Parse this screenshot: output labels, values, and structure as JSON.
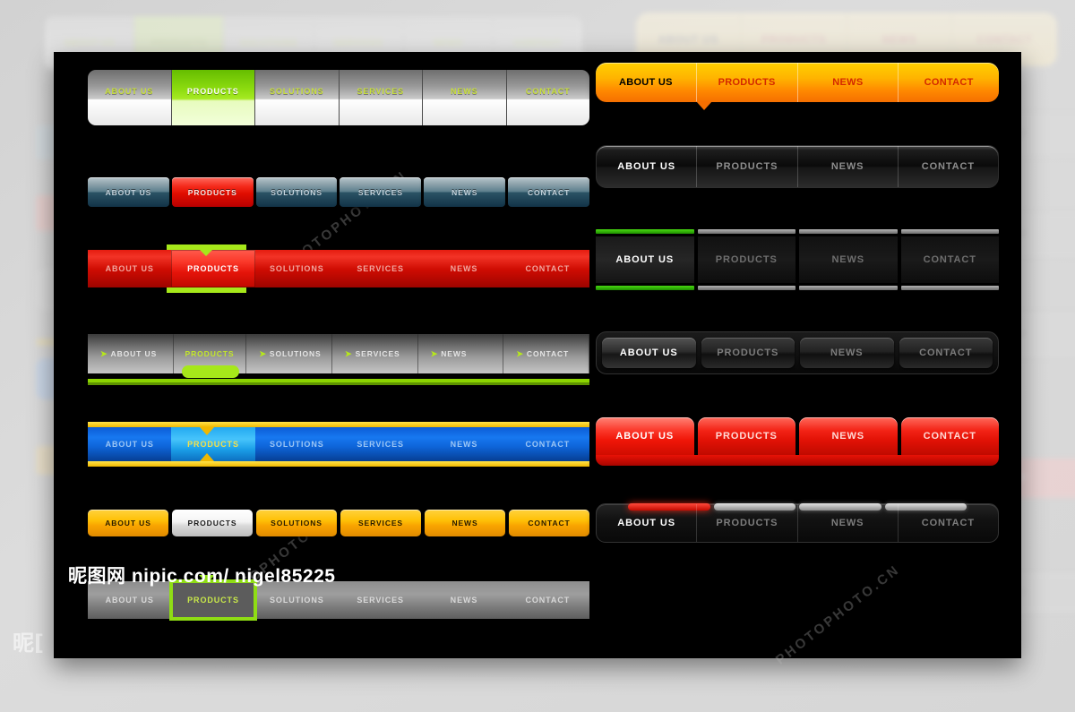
{
  "page": {
    "background_color": "#d8d8d8",
    "panel_color": "#000000",
    "credit_cn": "昵图网",
    "credit_url": "nipic.com/ nigel85225",
    "bottom_left_text": "昵[",
    "watermarks": [
      "PHOTOPHOTO.CN",
      "PHOTOPHOTO.CN",
      "PHOTOPHOTO.CN"
    ]
  },
  "left_column": {
    "labels6": [
      "ABOUT US",
      "PRODUCTS",
      "SOLUTIONS",
      "SERVICES",
      "NEWS",
      "CONTACT"
    ],
    "navs": [
      {
        "id": "silver-green-nav",
        "style": "silver-gradient-tabs",
        "active_index": 1,
        "accent": "#a6ea22",
        "text_color": "#c9e03a",
        "items": [
          "ABOUT US",
          "PRODUCTS",
          "SOLUTIONS",
          "SERVICES",
          "NEWS",
          "CONTACT"
        ]
      },
      {
        "id": "steel-blue-nav",
        "style": "glossy-steel-buttons",
        "active_index": 1,
        "accent": "#e00d00",
        "text_color": "#c8d8e2",
        "items": [
          "ABOUT US",
          "PRODUCTS",
          "SOLUTIONS",
          "SERVICES",
          "NEWS",
          "CONTACT"
        ]
      },
      {
        "id": "red-bar-nav",
        "style": "red-bar-green-tab",
        "active_index": 1,
        "accent": "#a6e81a",
        "text_color": "#f0a59e",
        "items": [
          "ABOUT US",
          "PRODUCTS",
          "SOLUTIONS",
          "SERVICES",
          "NEWS",
          "CONTACT"
        ]
      },
      {
        "id": "gray-arrow-nav",
        "style": "gray-gradient-arrow-bullets",
        "active_index": 1,
        "accent": "#8cd400",
        "text_color": "#e4e4e4",
        "bullet": "arrow-right-icon",
        "items": [
          "ABOUT US",
          "PRODUCTS",
          "SOLUTIONS",
          "SERVICES",
          "NEWS",
          "CONTACT"
        ]
      },
      {
        "id": "blue-yellow-rail-nav",
        "style": "blue-bar-yellow-rails",
        "active_index": 1,
        "accent": "#f0b800",
        "text_color": "#9cc6f5",
        "items": [
          "ABOUT US",
          "PRODUCTS",
          "SOLUTIONS",
          "SERVICES",
          "NEWS",
          "CONTACT"
        ]
      },
      {
        "id": "yellow-button-nav",
        "style": "yellow-rounded-buttons",
        "active_index": 1,
        "accent": "#ffc107",
        "text_color": "#2a1c00",
        "items": [
          "ABOUT US",
          "PRODUCTS",
          "SOLUTIONS",
          "SERVICES",
          "NEWS",
          "CONTACT"
        ]
      },
      {
        "id": "gray-green-outline-nav",
        "style": "gray-bar-green-outline-tab",
        "active_index": 1,
        "accent": "#8fdd14",
        "text_color": "#d8d8d8",
        "items": [
          "ABOUT US",
          "PRODUCTS",
          "SOLUTIONS",
          "SERVICES",
          "NEWS",
          "CONTACT"
        ]
      }
    ]
  },
  "right_column": {
    "labels4": [
      "ABOUT US",
      "PRODUCTS",
      "NEWS",
      "CONTACT"
    ],
    "navs": [
      {
        "id": "orange-rounded-nav",
        "style": "orange-gradient-rounded",
        "active_index": 0,
        "accent": "#ff8a00",
        "text_color": "#d42800",
        "active_text_color": "#000000",
        "items": [
          "ABOUT US",
          "PRODUCTS",
          "NEWS",
          "CONTACT"
        ]
      },
      {
        "id": "dark-glossy-nav",
        "style": "dark-glossy-rounded",
        "active_index": 0,
        "accent": "#ffffff",
        "text_color": "#8e8e8e",
        "items": [
          "ABOUT US",
          "PRODUCTS",
          "NEWS",
          "CONTACT"
        ]
      },
      {
        "id": "dark-green-rail-nav",
        "style": "dark-flat-green-rails",
        "active_index": 0,
        "accent": "#49d812",
        "text_color": "#6e6e6e",
        "items": [
          "ABOUT US",
          "PRODUCTS",
          "NEWS",
          "CONTACT"
        ]
      },
      {
        "id": "dark-tray-nav",
        "style": "dark-tray-embossed-buttons",
        "active_index": 0,
        "accent": "#545454",
        "text_color": "#7c7c7c",
        "items": [
          "ABOUT US",
          "PRODUCTS",
          "NEWS",
          "CONTACT"
        ]
      },
      {
        "id": "red-tab-nav",
        "style": "red-rounded-tabs",
        "active_index": 0,
        "accent": "#e21206",
        "text_color": "#ffd9d5",
        "items": [
          "ABOUT US",
          "PRODUCTS",
          "NEWS",
          "CONTACT"
        ]
      },
      {
        "id": "dark-pill-indicator-nav",
        "style": "dark-bar-pill-indicators",
        "active_index": 0,
        "accent": "#ff4a3c",
        "text_color": "#7d7d7d",
        "items": [
          "ABOUT US",
          "PRODUCTS",
          "NEWS",
          "CONTACT"
        ]
      }
    ]
  }
}
